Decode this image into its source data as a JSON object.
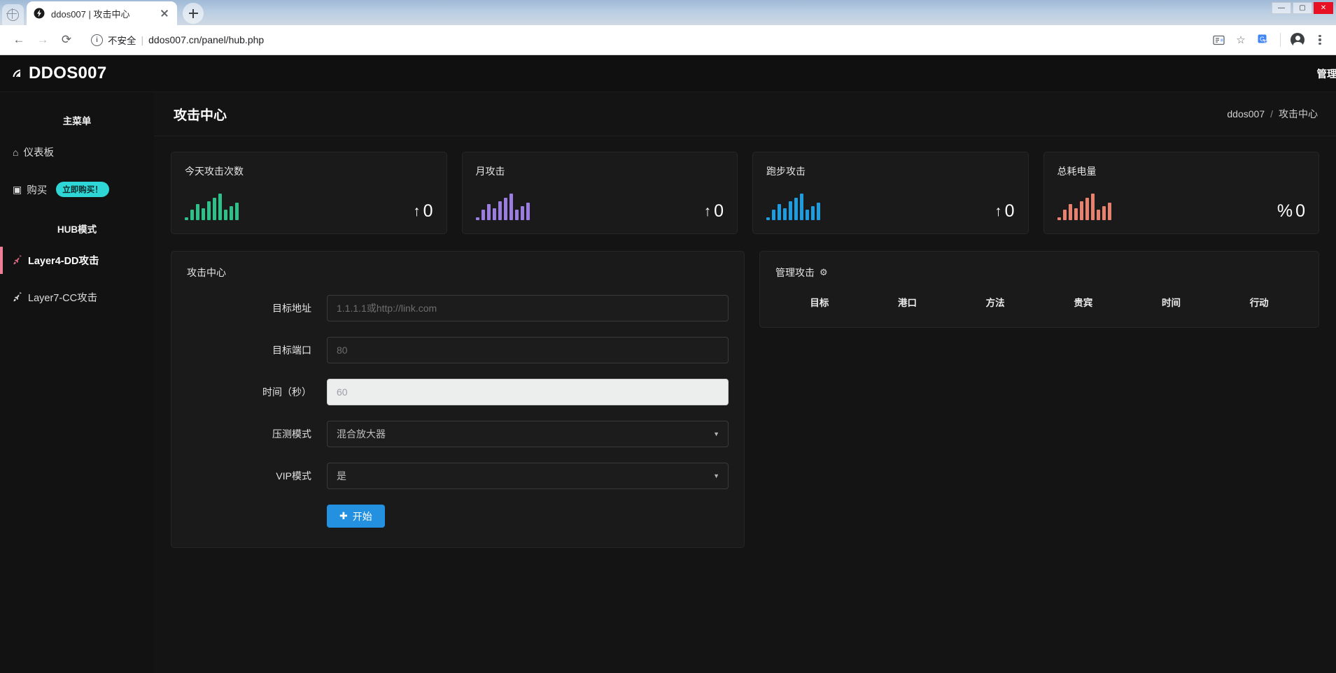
{
  "browser": {
    "tab": {
      "title": "ddos007 | 攻击中心",
      "favicon": "ddos-bolt-icon",
      "close": "×"
    },
    "newtab_label": "+",
    "window_buttons": [
      {
        "name": "minimize-button",
        "glyph": "—"
      },
      {
        "name": "maximize-button",
        "glyph": "▢"
      },
      {
        "name": "close-window-button",
        "glyph": "✕"
      }
    ],
    "nav": {
      "back": "←",
      "forward": "→",
      "reload": "⟳"
    },
    "omnibox": {
      "security_text": "不安全",
      "separator": "|",
      "url": "ddos007.cn/panel/hub.php",
      "info_glyph": "i"
    },
    "toolbar_icons": [
      {
        "name": "reading-mode-icon",
        "glyph": "▤"
      },
      {
        "name": "bookmark-star-icon",
        "glyph": "☆"
      },
      {
        "name": "translate-icon",
        "glyph": "G"
      },
      {
        "name": "profile-avatar-icon",
        "glyph": ""
      },
      {
        "name": "chrome-menu-icon",
        "glyph": "⋮"
      }
    ]
  },
  "topbar": {
    "logo_icon": "signal-wifi-icon",
    "logo_glyph": "))",
    "brand": "DDOS007",
    "admin_label": "管理员"
  },
  "sidebar": {
    "main_menu_title": "主菜单",
    "hub_title": "HUB模式",
    "items": [
      {
        "label": "仪表板",
        "icon": "home-icon",
        "glyph": "⌂",
        "active": false
      },
      {
        "label": "购买",
        "icon": "ticket-icon",
        "glyph": "▣",
        "active": false,
        "badge": "立即购买！"
      }
    ],
    "hub_items": [
      {
        "label": "Layer4-DD攻击",
        "icon": "rocket-icon",
        "glyph": "🚀",
        "active": true
      },
      {
        "label": "Layer7-CC攻击",
        "icon": "rocket-icon",
        "glyph": "🚀",
        "active": false
      }
    ]
  },
  "page": {
    "title": "攻击中心",
    "breadcrumb_root": "ddos007",
    "breadcrumb_sep": "/",
    "breadcrumb_current": "攻击中心"
  },
  "cards": [
    {
      "label": "今天攻击次数",
      "value": "0",
      "arrow": "↑",
      "suffix": "",
      "color": "#2fbf88",
      "spark": [
        4,
        14,
        22,
        16,
        26,
        30,
        36,
        14,
        19,
        24
      ]
    },
    {
      "label": "月攻击",
      "value": "0",
      "arrow": "↑",
      "suffix": "",
      "color": "#9b7ce0",
      "spark": [
        4,
        14,
        22,
        16,
        26,
        30,
        36,
        14,
        19,
        24
      ]
    },
    {
      "label": "跑步攻击",
      "value": "0",
      "arrow": "↑",
      "suffix": "",
      "color": "#1e9ce0",
      "spark": [
        4,
        14,
        22,
        16,
        26,
        30,
        36,
        14,
        19,
        24
      ]
    },
    {
      "label": "总耗电量",
      "value": "0",
      "arrow": "",
      "prefix": "%",
      "color": "#e8816e",
      "spark": [
        4,
        14,
        22,
        16,
        26,
        30,
        36,
        14,
        19,
        24
      ]
    }
  ],
  "attack_form": {
    "title": "攻击中心",
    "fields": [
      {
        "label": "目标地址",
        "type": "input",
        "value": "",
        "placeholder": "1.1.1.1或http://link.com",
        "theme": "dark",
        "name": "target-address-input"
      },
      {
        "label": "目标端口",
        "type": "input",
        "value": "",
        "placeholder": "80",
        "theme": "dark",
        "name": "target-port-input"
      },
      {
        "label": "时间（秒）",
        "type": "input",
        "value": "",
        "placeholder": "60",
        "theme": "light",
        "name": "duration-seconds-input"
      },
      {
        "label": "压测模式",
        "type": "select",
        "value": "混合放大器",
        "name": "attack-mode-select"
      },
      {
        "label": "VIP模式",
        "type": "select",
        "value": "是",
        "name": "vip-mode-select"
      }
    ],
    "submit": {
      "label": "开始",
      "plus": "✚"
    }
  },
  "manage_panel": {
    "title": "管理攻击",
    "gear_glyph": "⚙",
    "columns": [
      "目标",
      "港口",
      "方法",
      "贵宾",
      "时间",
      "行动"
    ],
    "rows": []
  },
  "chart_data": [
    {
      "type": "bar",
      "title": "今天攻击次数",
      "categories": [
        "1",
        "2",
        "3",
        "4",
        "5",
        "6",
        "7",
        "8",
        "9",
        "10"
      ],
      "values": [
        4,
        14,
        22,
        16,
        26,
        30,
        36,
        14,
        19,
        24
      ],
      "color": "#2fbf88",
      "ylabel": "",
      "xlabel": "",
      "grid": false
    },
    {
      "type": "bar",
      "title": "月攻击",
      "categories": [
        "1",
        "2",
        "3",
        "4",
        "5",
        "6",
        "7",
        "8",
        "9",
        "10"
      ],
      "values": [
        4,
        14,
        22,
        16,
        26,
        30,
        36,
        14,
        19,
        24
      ],
      "color": "#9b7ce0",
      "ylabel": "",
      "xlabel": "",
      "grid": false
    },
    {
      "type": "bar",
      "title": "跑步攻击",
      "categories": [
        "1",
        "2",
        "3",
        "4",
        "5",
        "6",
        "7",
        "8",
        "9",
        "10"
      ],
      "values": [
        4,
        14,
        22,
        16,
        26,
        30,
        36,
        14,
        19,
        24
      ],
      "color": "#1e9ce0",
      "ylabel": "",
      "xlabel": "",
      "grid": false
    },
    {
      "type": "bar",
      "title": "总耗电量",
      "categories": [
        "1",
        "2",
        "3",
        "4",
        "5",
        "6",
        "7",
        "8",
        "9",
        "10"
      ],
      "values": [
        4,
        14,
        22,
        16,
        26,
        30,
        36,
        14,
        19,
        24
      ],
      "color": "#e8816e",
      "ylabel": "",
      "xlabel": "",
      "grid": false
    }
  ]
}
